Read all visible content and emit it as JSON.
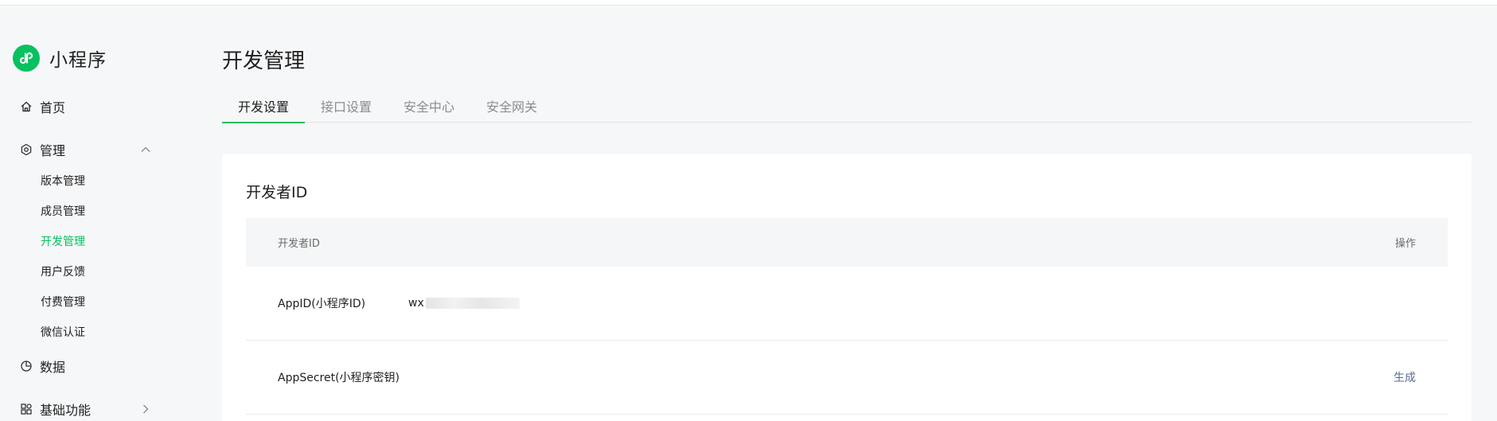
{
  "brand": {
    "name": "小程序",
    "logo_icon": "miniprogram-logo-icon",
    "color": "#07c160"
  },
  "sidebar": {
    "items": [
      {
        "label": "首页",
        "icon": "home-icon"
      },
      {
        "label": "管理",
        "icon": "settings-hexagon-icon",
        "expanded": true,
        "children": [
          {
            "label": "版本管理"
          },
          {
            "label": "成员管理"
          },
          {
            "label": "开发管理",
            "active": true
          },
          {
            "label": "用户反馈"
          },
          {
            "label": "付费管理"
          },
          {
            "label": "微信认证"
          }
        ]
      },
      {
        "label": "数据",
        "icon": "pie-chart-icon"
      },
      {
        "label": "基础功能",
        "icon": "apps-grid-icon",
        "expanded": false
      }
    ]
  },
  "page": {
    "title": "开发管理"
  },
  "tabs": [
    {
      "label": "开发设置",
      "active": true
    },
    {
      "label": "接口设置"
    },
    {
      "label": "安全中心"
    },
    {
      "label": "安全网关"
    }
  ],
  "developer_card": {
    "title": "开发者ID",
    "columns": {
      "name": "开发者ID",
      "action": "操作"
    },
    "rows": [
      {
        "label": "AppID(小程序ID)",
        "value_prefix": "wx",
        "value_redacted": true,
        "action": ""
      },
      {
        "label": "AppSecret(小程序密钥)",
        "value_prefix": "",
        "value_redacted": false,
        "action": "生成"
      }
    ]
  },
  "colors": {
    "accent": "#07c160",
    "link": "#576b95"
  }
}
